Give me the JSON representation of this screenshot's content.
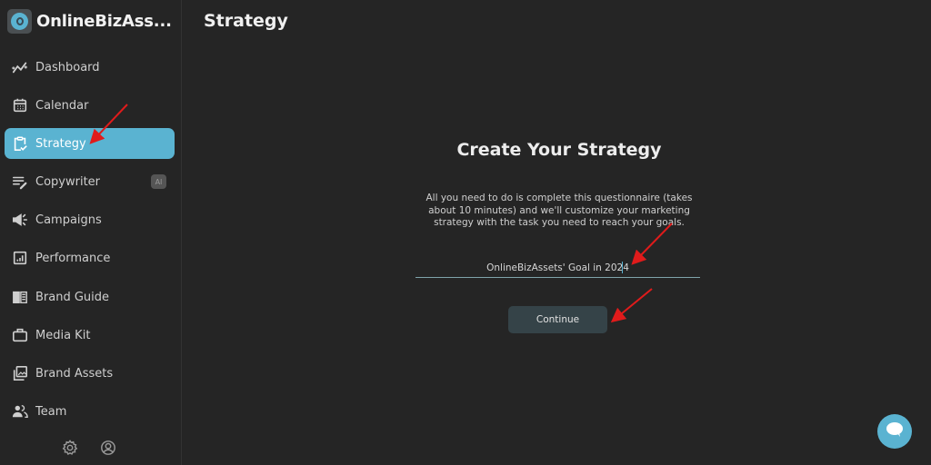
{
  "brand": {
    "name": "OnlineBizAss..."
  },
  "header": {
    "title": "Strategy"
  },
  "sidebar": {
    "items": [
      {
        "label": "Dashboard",
        "icon": "trend-icon",
        "active": false
      },
      {
        "label": "Calendar",
        "icon": "calendar-icon",
        "active": false
      },
      {
        "label": "Strategy",
        "icon": "clipboard-check-icon",
        "active": true
      },
      {
        "label": "Copywriter",
        "icon": "pen-lines-icon",
        "active": false,
        "badge": "AI"
      },
      {
        "label": "Campaigns",
        "icon": "megaphone-icon",
        "active": false
      },
      {
        "label": "Performance",
        "icon": "bar-chart-icon",
        "active": false
      },
      {
        "label": "Brand Guide",
        "icon": "book-icon",
        "active": false
      },
      {
        "label": "Media Kit",
        "icon": "briefcase-icon",
        "active": false
      },
      {
        "label": "Brand Assets",
        "icon": "images-icon",
        "active": false
      },
      {
        "label": "Team",
        "icon": "users-icon",
        "active": false
      }
    ],
    "footer": [
      "gear-icon",
      "user-circle-icon"
    ]
  },
  "main": {
    "title": "Create Your Strategy",
    "description": "All you need to do is complete this questionnaire (takes about 10 minutes) and we'll customize your marketing strategy with the task you need to reach your goals.",
    "goal_input": {
      "value": "OnlineBizAssets' Goal in 2024"
    },
    "continue_label": "Continue"
  },
  "chat": {
    "icon": "chat-bubble-icon"
  },
  "colors": {
    "accent": "#5ab3d1",
    "background": "#252525",
    "button": "#354348",
    "annotation": "#e01b1b"
  }
}
